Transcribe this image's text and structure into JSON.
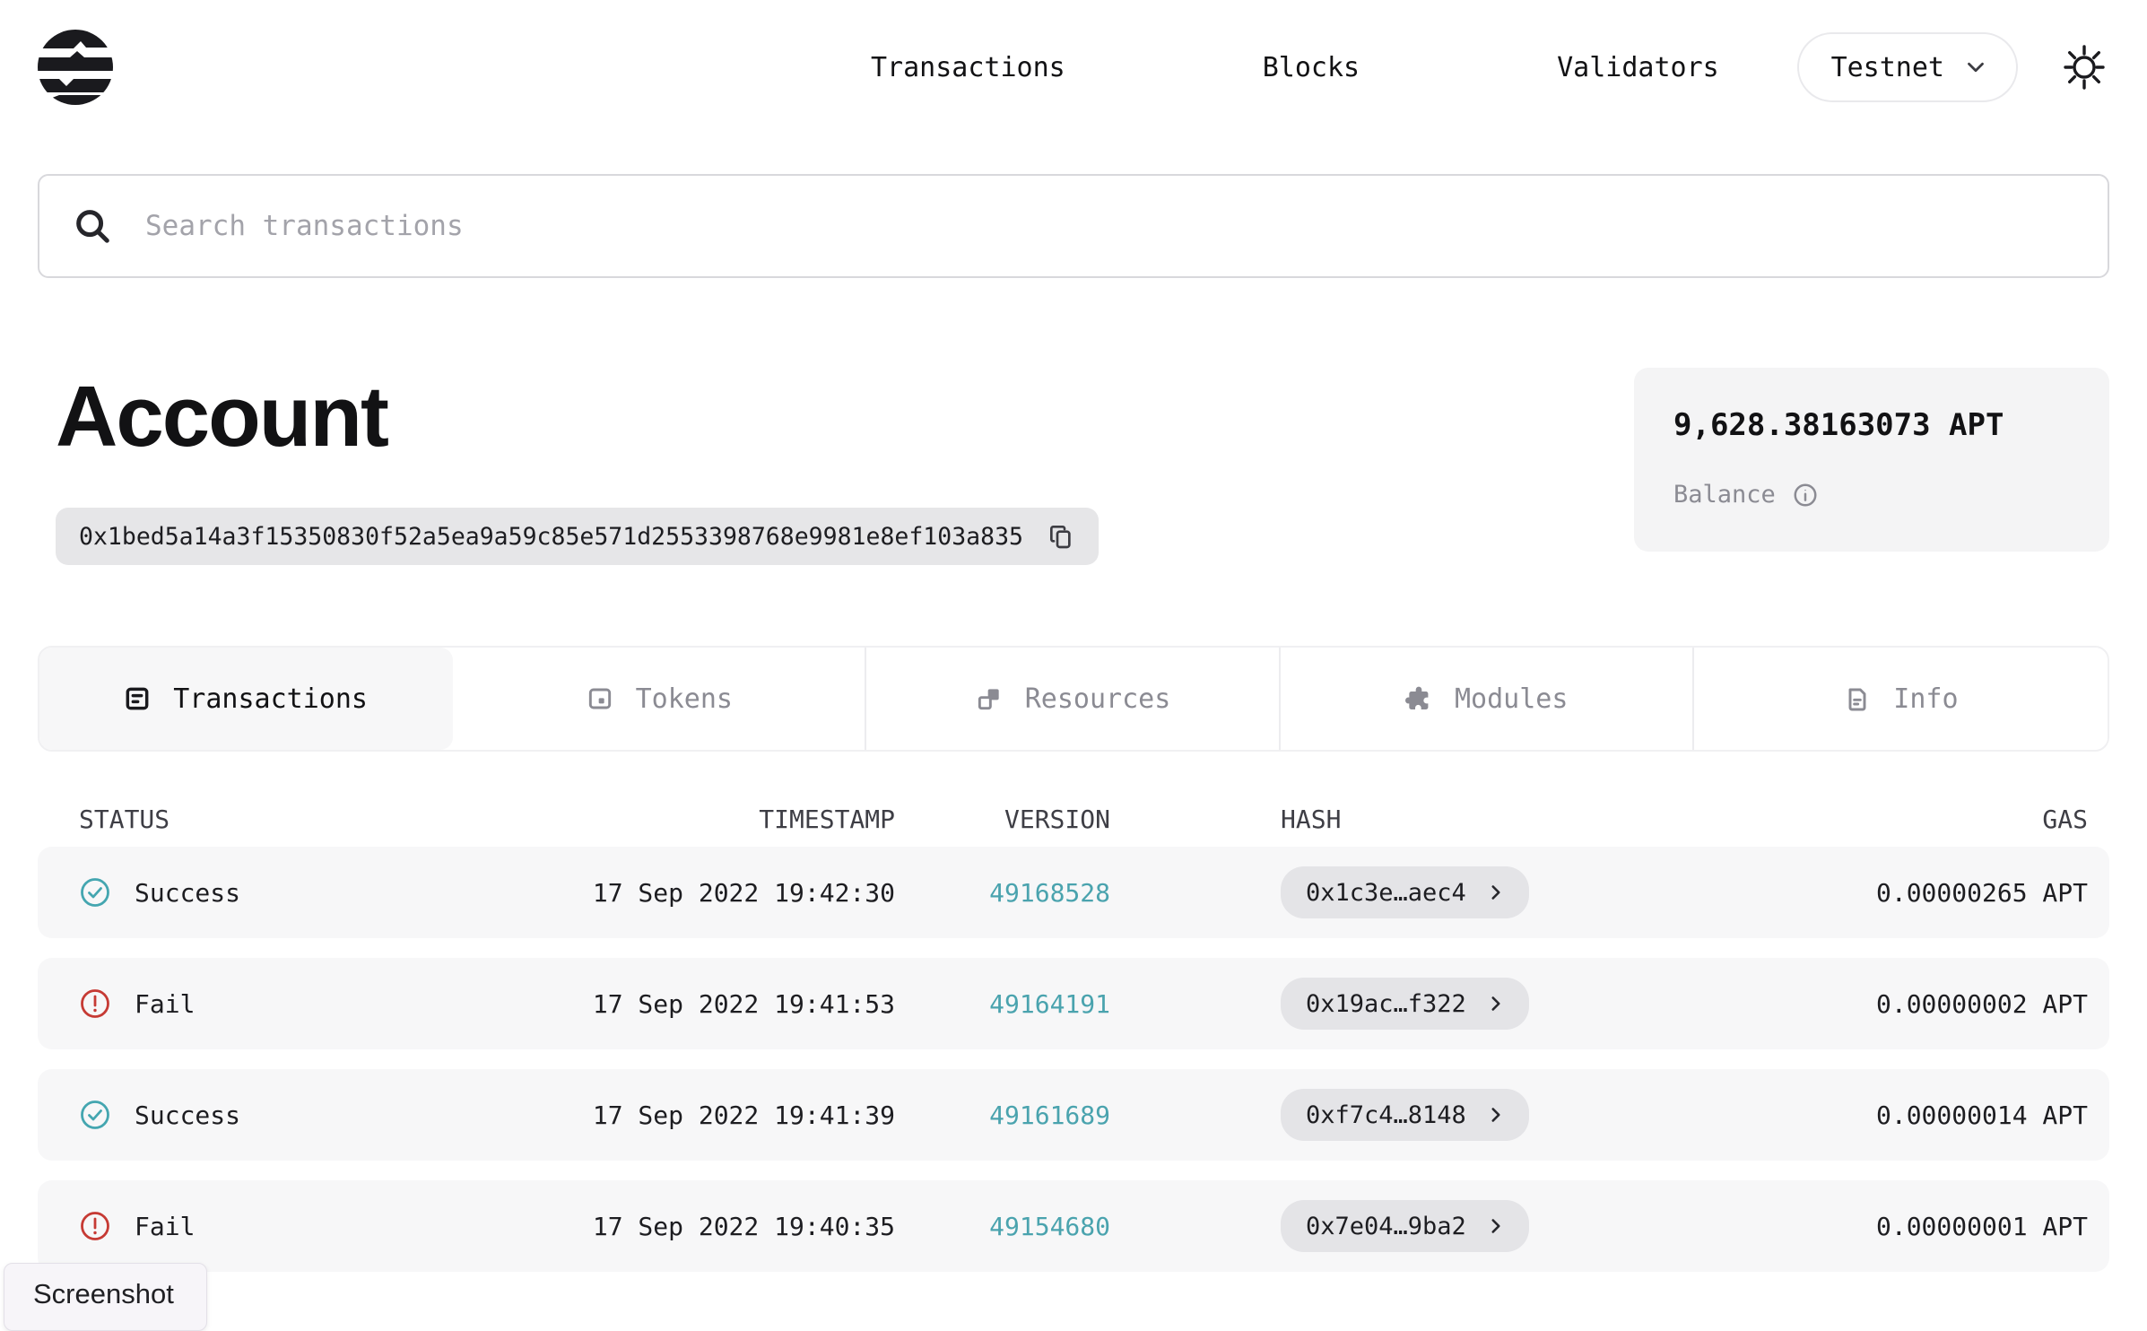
{
  "header": {
    "logo": "aptos-logo",
    "nav": [
      {
        "label": "Transactions"
      },
      {
        "label": "Blocks"
      },
      {
        "label": "Validators"
      }
    ],
    "network_selector": {
      "label": "Testnet"
    }
  },
  "search": {
    "placeholder": "Search transactions"
  },
  "account": {
    "title": "Account",
    "address": "0x1bed5a14a3f15350830f52a5ea9a59c85e571d2553398768e9981e8ef103a835",
    "balance": {
      "amount": "9,628.38163073 APT",
      "label": "Balance"
    }
  },
  "tabs": [
    {
      "label": "Transactions",
      "icon": "transactions-icon",
      "active": true
    },
    {
      "label": "Tokens",
      "icon": "tokens-icon",
      "active": false
    },
    {
      "label": "Resources",
      "icon": "resources-icon",
      "active": false
    },
    {
      "label": "Modules",
      "icon": "modules-icon",
      "active": false
    },
    {
      "label": "Info",
      "icon": "info-icon",
      "active": false
    }
  ],
  "table": {
    "columns": {
      "status": "STATUS",
      "timestamp": "TIMESTAMP",
      "version": "VERSION",
      "hash": "HASH",
      "gas": "GAS"
    },
    "rows": [
      {
        "status": "Success",
        "timestamp": "17 Sep 2022 19:42:30",
        "version": "49168528",
        "hash": "0x1c3e…aec4",
        "gas": "0.00000265 APT"
      },
      {
        "status": "Fail",
        "timestamp": "17 Sep 2022 19:41:53",
        "version": "49164191",
        "hash": "0x19ac…f322",
        "gas": "0.00000002 APT"
      },
      {
        "status": "Success",
        "timestamp": "17 Sep 2022 19:41:39",
        "version": "49161689",
        "hash": "0xf7c4…8148",
        "gas": "0.00000014 APT"
      },
      {
        "status": "Fail",
        "timestamp": "17 Sep 2022 19:40:35",
        "version": "49154680",
        "hash": "0x7e04…9ba2",
        "gas": "0.00000001 APT"
      }
    ]
  },
  "tooltip": {
    "label": "Screenshot"
  },
  "colors": {
    "link_teal": "#4aa3ae",
    "success": "#44a6b0",
    "fail": "#c63a34",
    "row_bg": "#f7f7f8",
    "chip_bg": "#e4e4e7",
    "muted_text": "#8b8b93"
  }
}
